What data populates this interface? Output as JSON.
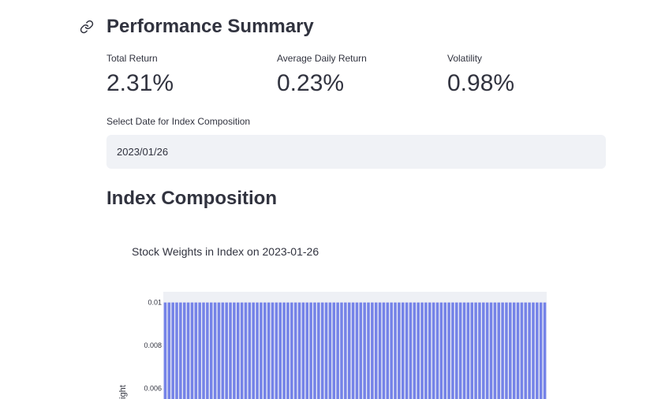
{
  "summary": {
    "title": "Performance Summary",
    "metrics": [
      {
        "label": "Total Return",
        "value": "2.31%"
      },
      {
        "label": "Average Daily Return",
        "value": "0.23%"
      },
      {
        "label": "Volatility",
        "value": "0.98%"
      }
    ]
  },
  "date_picker": {
    "label": "Select Date for Index Composition",
    "value": "2023/01/26"
  },
  "composition": {
    "title": "Index Composition"
  },
  "chart_data": {
    "type": "bar",
    "title": "Stock Weights in Index on 2023-01-26",
    "xlabel": "",
    "ylabel": "weight",
    "bar_count": 100,
    "bar_value": 0.01,
    "ylim_visible": [
      0.0055,
      0.0105
    ],
    "yticks": [
      0.01,
      0.008,
      0.006
    ],
    "ytick_labels": [
      "0.01",
      "0.008",
      "0.006"
    ],
    "bar_color": "#7583e8",
    "plot_background": "#eef0f5"
  }
}
